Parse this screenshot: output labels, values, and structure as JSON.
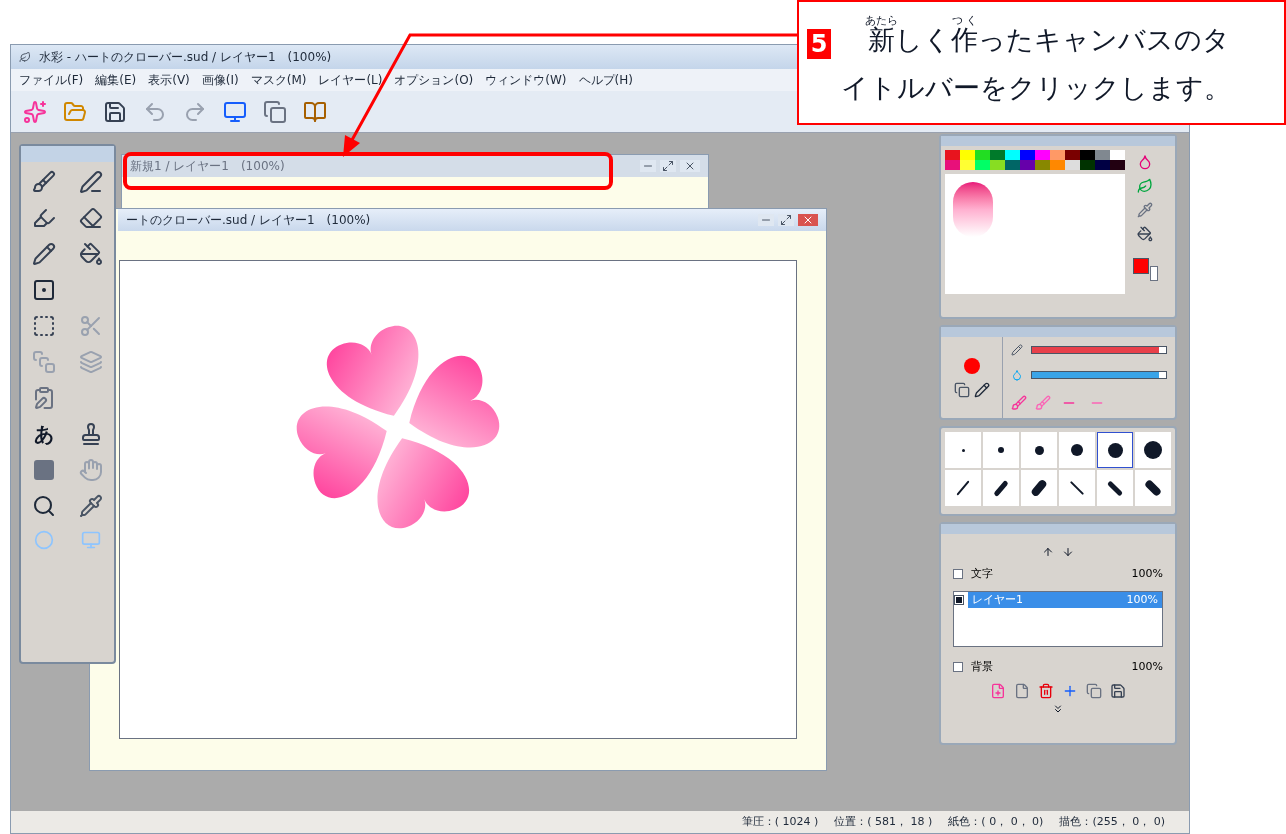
{
  "app_window": {
    "title": "水彩 - ハートのクローバー.sud / レイヤー1　(100%)",
    "menu": [
      "ファイル(F)",
      "編集(E)",
      "表示(V)",
      "画像(I)",
      "マスク(M)",
      "レイヤー(L)",
      "オプション(O)",
      "ウィンドウ(W)",
      "ヘルプ(H)"
    ]
  },
  "toolbox": {
    "text_tool_glyph": "あ"
  },
  "canvas_windows": [
    {
      "title": "新規1 / レイヤー1　(100%)",
      "active": false
    },
    {
      "title": "ートのクローバー.sud / レイヤー1　(100%)",
      "active": true
    }
  ],
  "palette": {
    "swatches": [
      {
        "color": "#e8141e"
      },
      {
        "color": "#ffff00"
      },
      {
        "color": "#22dd22"
      },
      {
        "color": "#007a2a"
      },
      {
        "color": "#00ffff"
      },
      {
        "color": "#0000ff"
      },
      {
        "color": "#ff00ff"
      },
      {
        "color": "#ff9966"
      },
      {
        "color": "#7a0000"
      },
      {
        "color": "#000000"
      },
      {
        "color": "#808890"
      },
      {
        "color": "#ffffff"
      },
      {
        "color": "#e8107a"
      },
      {
        "color": "#ffff33"
      },
      {
        "color": "#00ff66"
      },
      {
        "color": "#88dd22"
      },
      {
        "color": "#006666"
      },
      {
        "color": "#6600aa"
      },
      {
        "color": "#888800"
      },
      {
        "color": "#ff8800"
      },
      {
        "color": "#dddddd"
      },
      {
        "color": "#003300"
      },
      {
        "color": "#000044"
      },
      {
        "color": "#220011"
      }
    ],
    "current_colors": [
      {
        "color": "#ff0000"
      },
      {
        "color": "#ffffff"
      }
    ]
  },
  "sliders": [
    {
      "kind": "density",
      "level": 0.95
    },
    {
      "kind": "blur",
      "level": 0.95
    }
  ],
  "brushes": [
    {
      "kind": "dot",
      "selected": false
    },
    {
      "kind": "dot",
      "selected": false
    },
    {
      "kind": "dot",
      "selected": false
    },
    {
      "kind": "dot",
      "selected": false
    },
    {
      "kind": "dot",
      "selected": true
    },
    {
      "kind": "dot",
      "selected": false
    },
    {
      "kind": "stroke",
      "selected": false
    },
    {
      "kind": "stroke",
      "selected": false
    },
    {
      "kind": "stroke",
      "selected": false
    },
    {
      "kind": "stroke",
      "selected": false
    },
    {
      "kind": "stroke",
      "selected": false
    },
    {
      "kind": "stroke",
      "selected": false
    }
  ],
  "layers": {
    "top": {
      "name": "文字",
      "opacity": "100%",
      "visible": false
    },
    "list": [
      {
        "name": "レイヤー1",
        "opacity": "100%",
        "visible": true,
        "selected": true
      }
    ],
    "bottom": {
      "name": "背景",
      "opacity": "100%",
      "visible": false
    }
  },
  "status_bar": [
    "筆圧：( 1024 )",
    "位置：( 581， 18 )",
    "紙色：( 0， 0， 0)",
    "描色：(255， 0， 0)"
  ],
  "callout": {
    "number": "5",
    "segments": [
      {
        "text": "新",
        "ruby": "あたら"
      },
      {
        "text": "しく"
      },
      {
        "text": "作",
        "ruby": "つく"
      },
      {
        "text": "ったキャンバスのタイトルバーをクリックします。"
      }
    ]
  }
}
